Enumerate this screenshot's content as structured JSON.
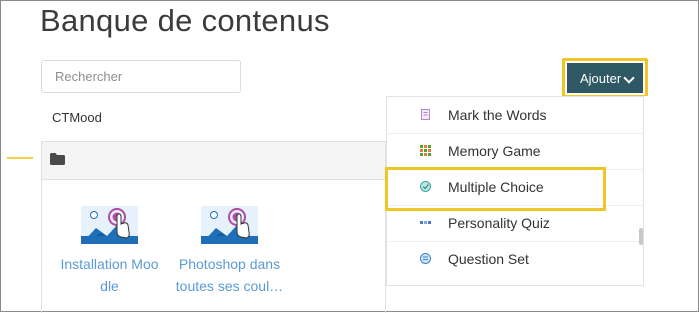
{
  "page": {
    "title": "Banque de contenus"
  },
  "search": {
    "placeholder": "Rechercher"
  },
  "breadcrumb": "CTMood",
  "toolbar": {
    "add_label": "Ajouter"
  },
  "dropdown": {
    "items": [
      {
        "label": "Mark the Words",
        "icon": "document-icon",
        "color": "#b48ac9"
      },
      {
        "label": "Memory Game",
        "icon": "grid-icon",
        "color": "#5a9e3a"
      },
      {
        "label": "Multiple Choice",
        "icon": "multiple-choice-icon",
        "color": "#3aa8a0",
        "highlighted": true
      },
      {
        "label": "Personality Quiz",
        "icon": "quiz-icon",
        "color": "#4a7bc8"
      },
      {
        "label": "Question Set",
        "icon": "question-set-icon",
        "color": "#3e86c6"
      }
    ]
  },
  "content_items": [
    {
      "title_line1": "Installation Moo",
      "title_line2": "dle",
      "icon": "interactive-video-icon"
    },
    {
      "title_line1": "Photoshop dans",
      "title_line2": "toutes ses coul…",
      "icon": "interactive-video-icon"
    }
  ],
  "colors": {
    "accent_button": "#2e5964",
    "highlight": "#f0c626",
    "link": "#5b9bd5"
  }
}
